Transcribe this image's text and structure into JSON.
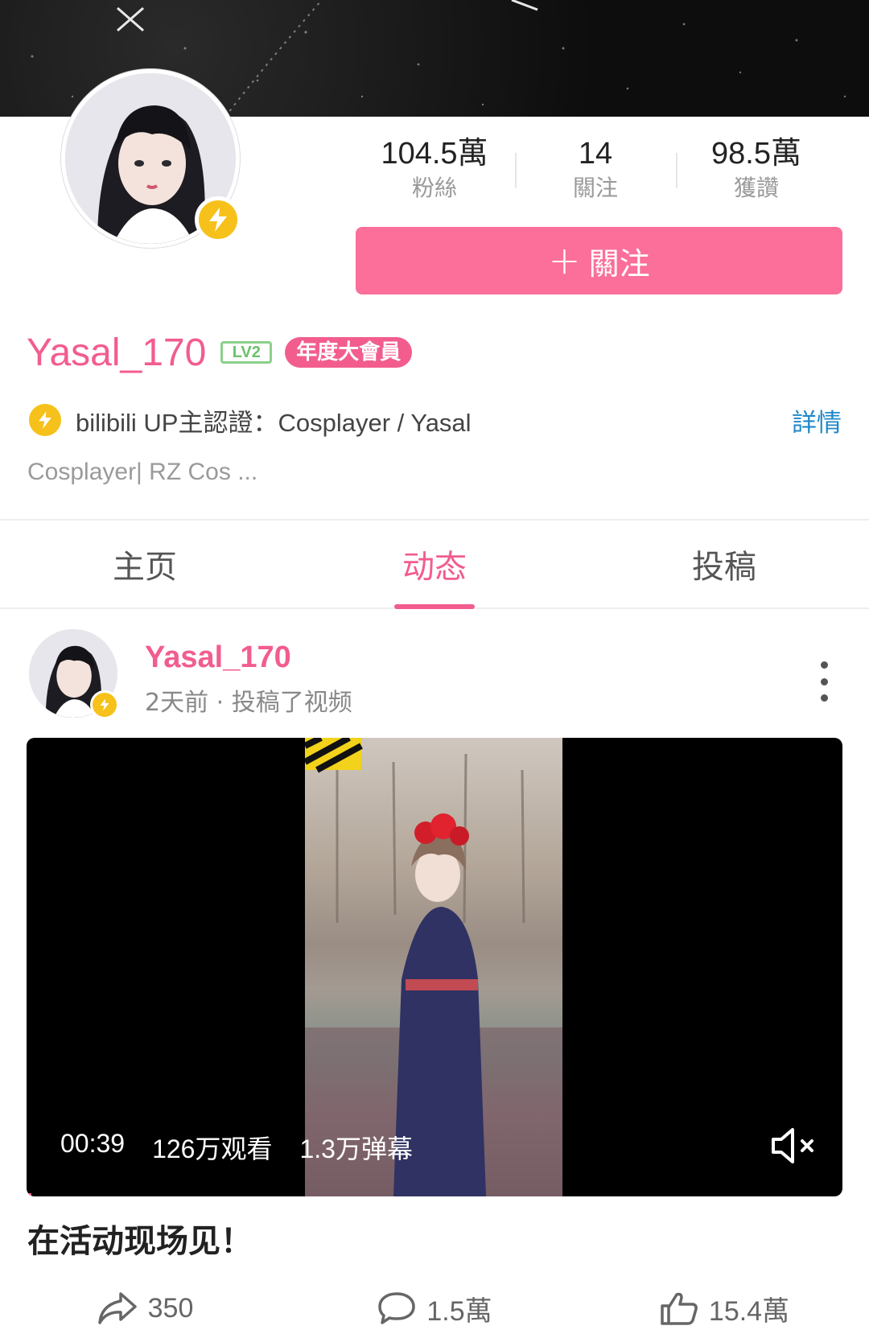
{
  "profile": {
    "username": "Yasal_170",
    "level_badge": "LV2",
    "vip_badge": "年度大會員",
    "verify_text": "bilibili UP主認證：Cosplayer / Yasal",
    "detail_link": "詳情",
    "bio": "Cosplayer| RZ Cos ..."
  },
  "stats": [
    {
      "value": "104.5萬",
      "label": "粉絲"
    },
    {
      "value": "14",
      "label": "關注"
    },
    {
      "value": "98.5萬",
      "label": "獲讚"
    }
  ],
  "follow_button": {
    "plus": "+",
    "label": "關注"
  },
  "tabs": [
    {
      "label": "主页",
      "active": false
    },
    {
      "label": "动态",
      "active": true
    },
    {
      "label": "投稿",
      "active": false
    }
  ],
  "post": {
    "author": "Yasal_170",
    "meta": "2天前 · 投稿了视频",
    "video": {
      "duration": "00:39",
      "views": "126万观看",
      "danmaku": "1.3万弹幕"
    },
    "title": "在活动现场见！",
    "actions": {
      "share": "350",
      "comment": "1.5萬",
      "like": "15.4萬"
    }
  },
  "colors": {
    "brand_pink": "#f25d8e",
    "follow_button": "#fb6f9a",
    "verify_yellow": "#f7c11b",
    "link_blue": "#1e88c9"
  },
  "icons": {
    "verify": "lightning-bolt-icon",
    "more": "more-vertical-icon",
    "mute": "speaker-muted-icon",
    "share": "share-arrow-icon",
    "comment": "comment-bubble-icon",
    "like": "thumbs-up-icon"
  }
}
